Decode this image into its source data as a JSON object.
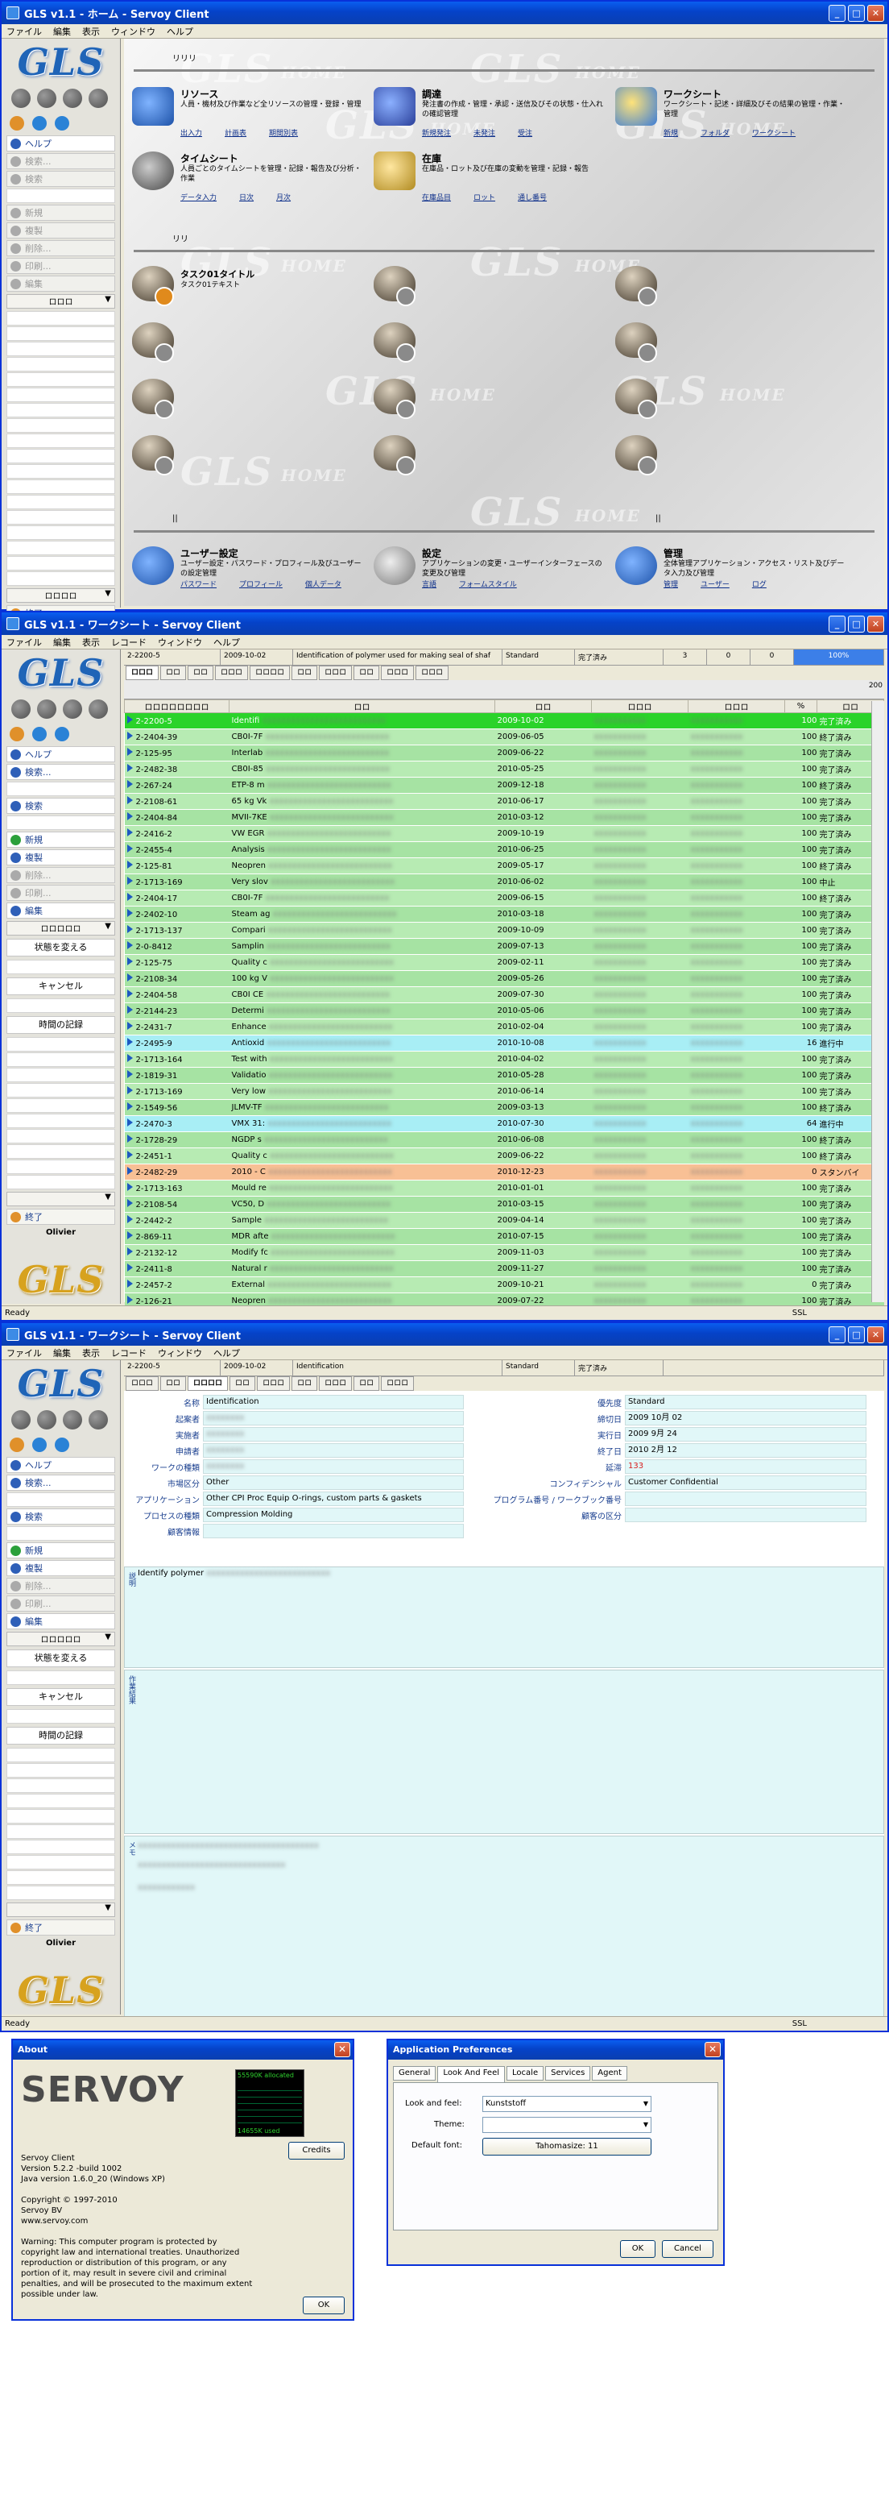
{
  "home": {
    "title": "GLS v1.1 - ホーム - Servoy Client",
    "menu": [
      "ファイル",
      "編集",
      "表示",
      "ウィンドウ",
      "ヘルプ"
    ],
    "sidebar": {
      "items": [
        "ヘルプ",
        "検索...",
        "検索",
        "新規",
        "複製",
        "削除...",
        "印刷...",
        "編集"
      ],
      "select_label": "ロロロ",
      "footer": "ロロロロ",
      "exit": "終了"
    },
    "section1_label": "リリリ",
    "section2_label": "リリ",
    "tiles": [
      {
        "title": "リソース",
        "desc": "人員・機材及び作業など全リソースの管理・登録・管理",
        "links": [
          "出入力",
          "計画表",
          "期間別表"
        ]
      },
      {
        "title": "調達",
        "desc": "発注書の作成・管理・承認・送信及びその状態・仕入れの確認管理",
        "links": [
          "新規発注",
          "未発注",
          "受注"
        ]
      },
      {
        "title": "ワークシート",
        "desc": "ワークシート・記述・詳細及びその結果の管理・作業・管理",
        "links": [
          "新規",
          "フォルダ",
          "ワークシート"
        ]
      },
      {
        "title": "タイムシート",
        "desc": "人員ごとのタイムシートを管理・記録・報告及び分析・作業",
        "links": [
          "データ入力",
          "日次",
          "月次"
        ]
      },
      {
        "title": "在庫",
        "desc": "在庫品・ロット及び在庫の変動を管理・記録・報告",
        "links": [
          "在庫品目",
          "ロット",
          "通し番号"
        ]
      }
    ],
    "task_title": "タスク01タイトル",
    "task_sub": "タスク01テキスト",
    "bottom_tiles": [
      {
        "title": "ユーザー設定",
        "desc": "ユーザー設定・パスワード・プロフィール及びユーザーの設定管理",
        "links": [
          "パスワード",
          "プロフィール",
          "個人データ"
        ]
      },
      {
        "title": "設定",
        "desc": "アプリケーションの変更・ユーザーインターフェースの変更及び管理",
        "links": [
          "言語",
          "フォームスタイル"
        ]
      },
      {
        "title": "管理",
        "desc": "全体管理アプリケーション・アクセス・リスト及びデータ入力及び管理",
        "links": [
          "管理",
          "ユーザー",
          "ログ"
        ]
      }
    ]
  },
  "worksheet": {
    "title": "GLS v1.1 - ワークシート - Servoy Client",
    "menu": [
      "ファイル",
      "編集",
      "表示",
      "レコード",
      "ウィンドウ",
      "ヘルプ"
    ],
    "sidebar_items": [
      "ヘルプ",
      "検索...",
      "検索",
      "新規",
      "複製",
      "削除...",
      "印刷...",
      "編集"
    ],
    "side_buttons": [
      "状態を変える",
      "キャンセル",
      "時間の記録"
    ],
    "select_label": "ロロロロロ",
    "exit": "終了",
    "user": "Olivier",
    "info": [
      "2-2200-5",
      "2009-10-02",
      "Identification of polymer used for making seal of shaf",
      "Standard",
      "完了済み",
      "3",
      "0",
      "0",
      "100%"
    ],
    "tabs": [
      "ロロロ",
      "ロロ",
      "ロロ",
      "ロロロ",
      "ロロロロ",
      "ロロ",
      "ロロロ",
      "ロロ",
      "ロロロ",
      "ロロロ"
    ],
    "scale_label": "200",
    "columns": [
      "ロロロロロロロロ",
      "ロロ",
      "ロロ",
      "ロロロ",
      "ロロロ",
      "%",
      "ロロ"
    ],
    "rows": [
      [
        "2-2200-5",
        "Identifi",
        "2009-10-02",
        "100",
        "完了済み"
      ],
      [
        "2-2404-39",
        "CB0I-7F",
        "2009-06-05",
        "100",
        "終了済み"
      ],
      [
        "2-125-95",
        "Interlab",
        "2009-06-22",
        "100",
        "完了済み"
      ],
      [
        "2-2482-38",
        "CB0I-85",
        "2010-05-25",
        "100",
        "完了済み"
      ],
      [
        "2-267-24",
        "ETP-8 m",
        "2009-12-18",
        "100",
        "終了済み"
      ],
      [
        "2-2108-61",
        "65 kg Vk",
        "2010-06-17",
        "100",
        "完了済み"
      ],
      [
        "2-2404-84",
        "MVII-7KE",
        "2010-03-12",
        "100",
        "完了済み"
      ],
      [
        "2-2416-2",
        "VW EGR",
        "2009-10-19",
        "100",
        "完了済み"
      ],
      [
        "2-2455-4",
        "Analysis",
        "2010-06-25",
        "100",
        "完了済み"
      ],
      [
        "2-125-81",
        "Neopren",
        "2009-05-17",
        "100",
        "終了済み"
      ],
      [
        "2-1713-169",
        "Very slov",
        "2010-06-02",
        "100",
        "中止"
      ],
      [
        "2-2404-17",
        "CB0I-7F",
        "2009-06-15",
        "100",
        "終了済み"
      ],
      [
        "2-2402-10",
        "Steam ag",
        "2010-03-18",
        "100",
        "完了済み"
      ],
      [
        "2-1713-137",
        "Compari",
        "2009-10-09",
        "100",
        "完了済み"
      ],
      [
        "2-0-8412",
        "Samplin",
        "2009-07-13",
        "100",
        "完了済み"
      ],
      [
        "2-125-75",
        "Quality c",
        "2009-02-11",
        "100",
        "完了済み"
      ],
      [
        "2-2108-34",
        "100 kg V",
        "2009-05-26",
        "100",
        "完了済み"
      ],
      [
        "2-2404-58",
        "CB0I CE",
        "2009-07-30",
        "100",
        "完了済み"
      ],
      [
        "2-2144-23",
        "Determi",
        "2010-05-06",
        "100",
        "完了済み"
      ],
      [
        "2-2431-7",
        "Enhance",
        "2010-02-04",
        "100",
        "完了済み"
      ],
      [
        "2-2495-9",
        "Antioxid",
        "2010-10-08",
        "16",
        "進行中"
      ],
      [
        "2-1713-164",
        "Test with",
        "2010-04-02",
        "100",
        "完了済み"
      ],
      [
        "2-1819-31",
        "Validatio",
        "2010-05-28",
        "100",
        "完了済み"
      ],
      [
        "2-1713-169",
        "Very low",
        "2010-06-14",
        "100",
        "完了済み"
      ],
      [
        "2-1549-56",
        "JLMV-TF",
        "2009-03-13",
        "100",
        "終了済み"
      ],
      [
        "2-2470-3",
        "VMX 31:",
        "2010-07-30",
        "64",
        "進行中"
      ],
      [
        "2-1728-29",
        "NGDP s",
        "2010-06-08",
        "100",
        "終了済み"
      ],
      [
        "2-2451-1",
        "Quality c",
        "2009-06-22",
        "100",
        "終了済み"
      ],
      [
        "2-2482-29",
        "2010 - C",
        "2010-12-23",
        "0",
        "スタンバイ"
      ],
      [
        "2-1713-163",
        "Mould re",
        "2010-01-01",
        "100",
        "完了済み"
      ],
      [
        "2-2108-54",
        "VC50, D",
        "2010-03-15",
        "100",
        "完了済み"
      ],
      [
        "2-2442-2",
        "Sample",
        "2009-04-14",
        "100",
        "完了済み"
      ],
      [
        "2-869-11",
        "MDR afte",
        "2010-07-15",
        "100",
        "完了済み"
      ],
      [
        "2-2132-12",
        "Modify fc",
        "2009-11-03",
        "100",
        "完了済み"
      ],
      [
        "2-2411-8",
        "Natural r",
        "2009-11-27",
        "100",
        "完了済み"
      ],
      [
        "2-2457-2",
        "External",
        "2009-10-21",
        "0",
        "完了済み"
      ],
      [
        "2-126-21",
        "Neopren",
        "2009-07-22",
        "100",
        "完了済み"
      ]
    ],
    "status": "Ready",
    "ssl": "SSL"
  },
  "detail": {
    "title": "GLS v1.1 - ワークシート - Servoy Client",
    "info": [
      "2-2200-5",
      "2009-10-02",
      "Identification",
      "Standard",
      "完了済み"
    ],
    "fields_left": [
      {
        "label": "名称",
        "value": "Identification"
      },
      {
        "label": "起案者",
        "value": ""
      },
      {
        "label": "実施者",
        "value": ""
      },
      {
        "label": "申請者",
        "value": ""
      },
      {
        "label": "ワークの種類",
        "value": ""
      },
      {
        "label": "市場区分",
        "value": "Other"
      },
      {
        "label": "アプリケーション",
        "value": "Other CPI Proc Equip O-rings, custom parts & gaskets"
      },
      {
        "label": "プロセスの種類",
        "value": "Compression Molding"
      },
      {
        "label": "顧客情報",
        "value": ""
      }
    ],
    "fields_right": [
      {
        "label": "優先度",
        "value": "Standard"
      },
      {
        "label": "締切日",
        "value": "2009 10月 02"
      },
      {
        "label": "実行日",
        "value": "2009 9月 24"
      },
      {
        "label": "終了日",
        "value": "2010 2月 12"
      },
      {
        "label": "延滞",
        "value": "133"
      },
      {
        "label": "コンフィデンシャル",
        "value": "Customer Confidential"
      },
      {
        "label": "プログラム番号 / ワークブック番号",
        "value": ""
      },
      {
        "label": "顧客の区分",
        "value": ""
      }
    ],
    "desc_label": "説明",
    "desc_text": "Identify polymer",
    "result_label": "作業結果",
    "memo_label": "メモ"
  },
  "about": {
    "title": "About",
    "logo": "SERVOY",
    "mem_allocated": "55590K allocated",
    "mem_used": "14655K used",
    "credits": "Credits",
    "lines": [
      "Servoy Client",
      "Version 5.2.2 -build 1002",
      "Java version 1.6.0_20 (Windows XP)",
      "",
      "Copyright © 1997-2010",
      "Servoy BV",
      "www.servoy.com"
    ],
    "warning": "Warning: This computer program is protected by copyright law and international treaties. Unauthorized reproduction or distribution of this program, or any portion of it, may result in severe civil and criminal penalties, and will be prosecuted to the maximum extent possible under law.",
    "ok": "OK"
  },
  "prefs": {
    "title": "Application Preferences",
    "tabs": [
      "General",
      "Look And Feel",
      "Locale",
      "Services",
      "Agent"
    ],
    "laf_label": "Look and feel:",
    "laf_value": "Kunststoff",
    "theme_label": "Theme:",
    "theme_value": "",
    "font_label": "Default font:",
    "font_value": "Tahomasize: 11",
    "ok": "OK",
    "cancel": "Cancel"
  }
}
